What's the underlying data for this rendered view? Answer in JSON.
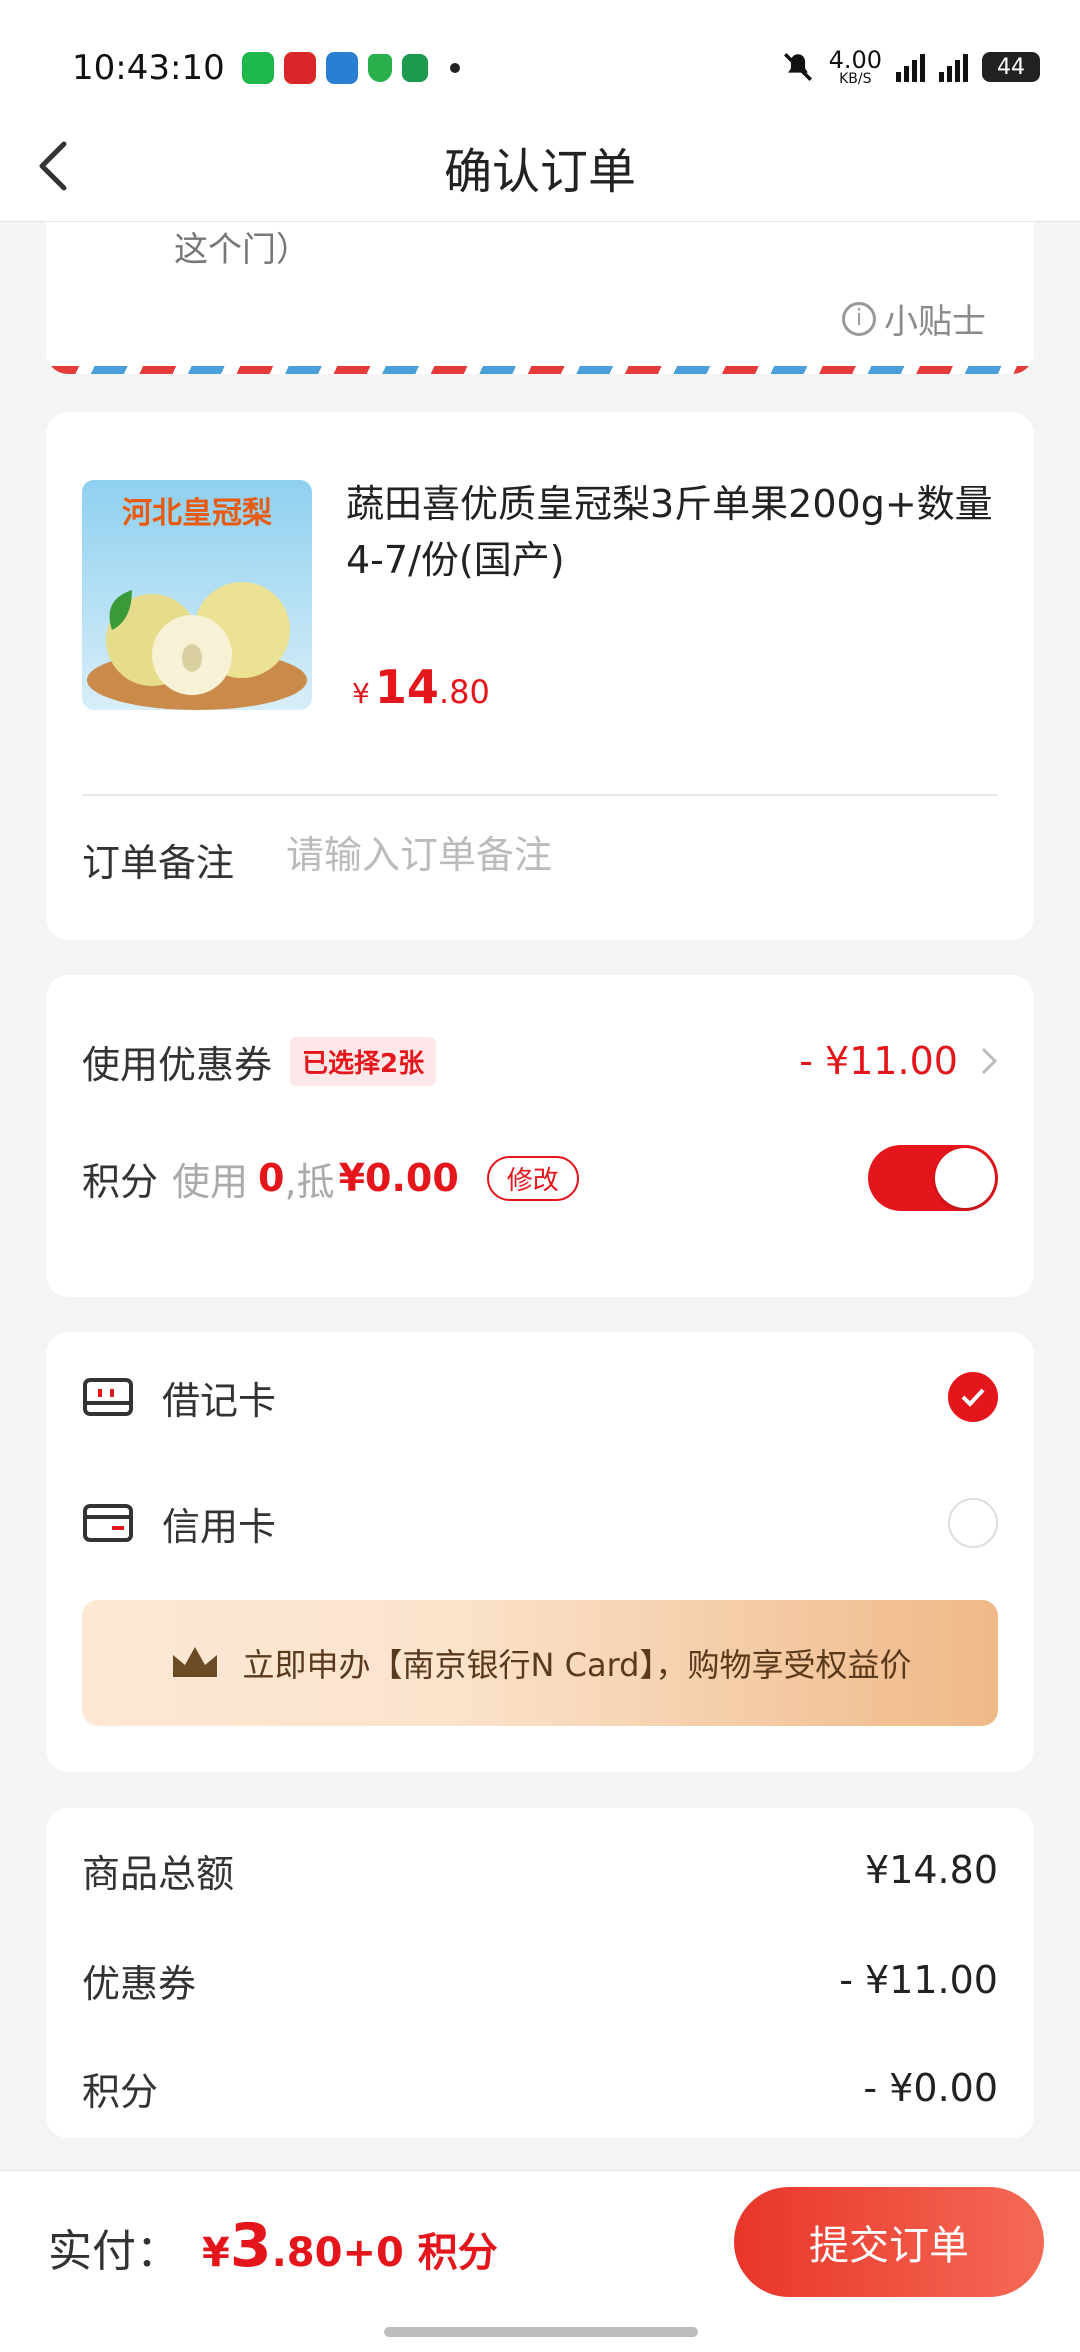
{
  "status_bar": {
    "time": "10:43:10",
    "network_speed": "4.00",
    "network_unit": "KB/S",
    "battery": "44"
  },
  "header": {
    "title": "确认订单",
    "back_icon": "chevron-left-icon"
  },
  "address": {
    "text_fragment": "这个门）",
    "tip_label": "小贴士"
  },
  "product": {
    "image_text": "河北皇冠梨",
    "title": "蔬田喜优质皇冠梨3斤单果200g+数量4-7/份(国产)",
    "price_currency": "¥",
    "price_int": "14",
    "price_dec": ".80",
    "remark_label": "订单备注",
    "remark_placeholder": "请输入订单备注"
  },
  "discounts": {
    "coupon_label": "使用优惠券",
    "coupon_badge": "已选择2张",
    "coupon_value": "- ¥11.00",
    "points_label": "积分",
    "points_use_text": "使用",
    "points_count": "0",
    "points_offset_text": ",抵",
    "points_money": "¥0.00",
    "modify_label": "修改",
    "points_toggle_on": true
  },
  "payment": {
    "debit_label": "借记卡",
    "credit_label": "信用卡",
    "selected": "debit",
    "banner_text": "立即申办【南京银行N Card】，购物享受权益价"
  },
  "summary": {
    "rows": [
      {
        "label": "商品总额",
        "value": "¥14.80"
      },
      {
        "label": "优惠券",
        "value": "- ¥11.00"
      },
      {
        "label": "积分",
        "value": "- ¥0.00"
      }
    ]
  },
  "footer": {
    "pay_label": "实付：",
    "currency": "¥",
    "amount_int": "3",
    "amount_dec": ".80",
    "points_suffix": "+0 积分",
    "submit_label": "提交订单"
  },
  "colors": {
    "accent": "#e4151b",
    "background": "#f4f4f4",
    "card": "#ffffff"
  }
}
